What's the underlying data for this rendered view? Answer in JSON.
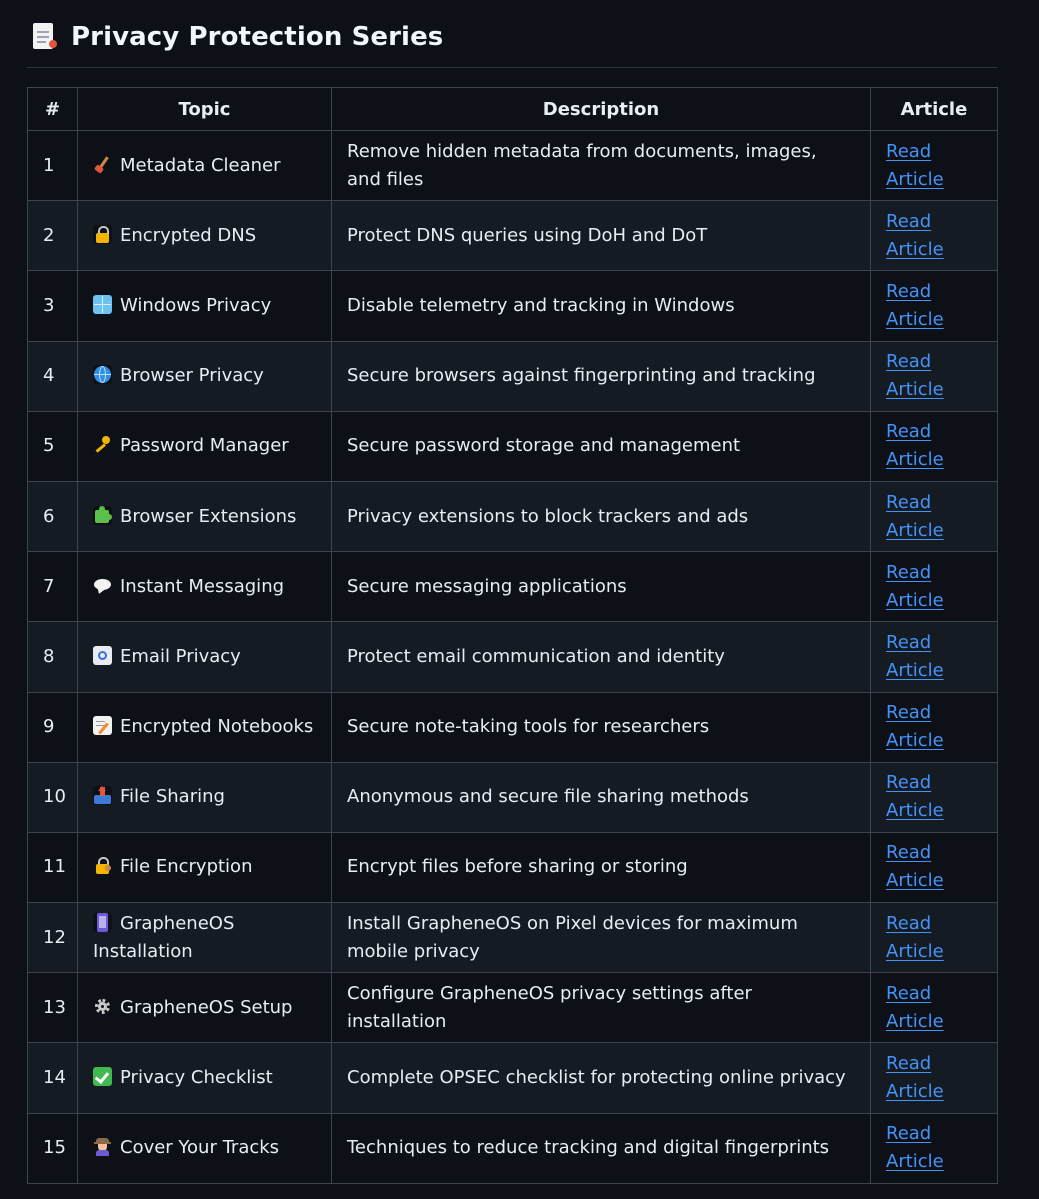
{
  "heading": {
    "title": "Privacy Protection Series",
    "icon": "page-facing-up-icon"
  },
  "table": {
    "headers": [
      "#",
      "Topic",
      "Description",
      "Article"
    ],
    "rows": [
      {
        "num": "1",
        "icon": "broom-icon",
        "topic": "Metadata Cleaner",
        "description": "Remove hidden metadata from documents, images, and files",
        "link": "Read Article"
      },
      {
        "num": "2",
        "icon": "lock-icon",
        "topic": "Encrypted DNS",
        "description": "Protect DNS queries using DoH and DoT",
        "link": "Read Article"
      },
      {
        "num": "3",
        "icon": "windows-icon",
        "topic": "Windows Privacy",
        "description": "Disable telemetry and tracking in Windows",
        "link": "Read Article"
      },
      {
        "num": "4",
        "icon": "globe-icon",
        "topic": "Browser Privacy",
        "description": "Secure browsers against fingerprinting and tracking",
        "link": "Read Article"
      },
      {
        "num": "5",
        "icon": "key-icon",
        "topic": "Password Manager",
        "description": "Secure password storage and management",
        "link": "Read Article"
      },
      {
        "num": "6",
        "icon": "puzzle-piece-icon",
        "topic": "Browser Extensions",
        "description": "Privacy extensions to block trackers and ads",
        "link": "Read Article"
      },
      {
        "num": "7",
        "icon": "speech-balloon-icon",
        "topic": "Instant Messaging",
        "description": "Secure messaging applications",
        "link": "Read Article"
      },
      {
        "num": "8",
        "icon": "email-icon",
        "topic": "Email Privacy",
        "description": "Protect email communication and identity",
        "link": "Read Article"
      },
      {
        "num": "9",
        "icon": "memo-icon",
        "topic": "Encrypted Notebooks",
        "description": "Secure note-taking tools for researchers",
        "link": "Read Article"
      },
      {
        "num": "10",
        "icon": "outbox-tray-icon",
        "topic": "File Sharing",
        "description": "Anonymous and secure file sharing methods",
        "link": "Read Article"
      },
      {
        "num": "11",
        "icon": "lock-with-key-icon",
        "topic": "File Encryption",
        "description": "Encrypt files before sharing or storing",
        "link": "Read Article"
      },
      {
        "num": "12",
        "icon": "mobile-phone-icon",
        "topic": "GrapheneOS Installation",
        "description": "Install GrapheneOS on Pixel devices for maximum mobile privacy",
        "link": "Read Article"
      },
      {
        "num": "13",
        "icon": "gear-icon",
        "topic": "GrapheneOS Setup",
        "description": "Configure GrapheneOS privacy settings after installation",
        "link": "Read Article"
      },
      {
        "num": "14",
        "icon": "check-mark-icon",
        "topic": "Privacy Checklist",
        "description": "Complete OPSEC checklist for protecting online privacy",
        "link": "Read Article"
      },
      {
        "num": "15",
        "icon": "detective-icon",
        "topic": "Cover Your Tracks",
        "description": "Techniques to reduce tracking and digital fingerprints",
        "link": "Read Article"
      }
    ]
  },
  "colors": {
    "background": "#0d1117",
    "row_alt": "#151b23",
    "border": "#3d444d",
    "link": "#4493f8",
    "text": "#e6edf3"
  }
}
